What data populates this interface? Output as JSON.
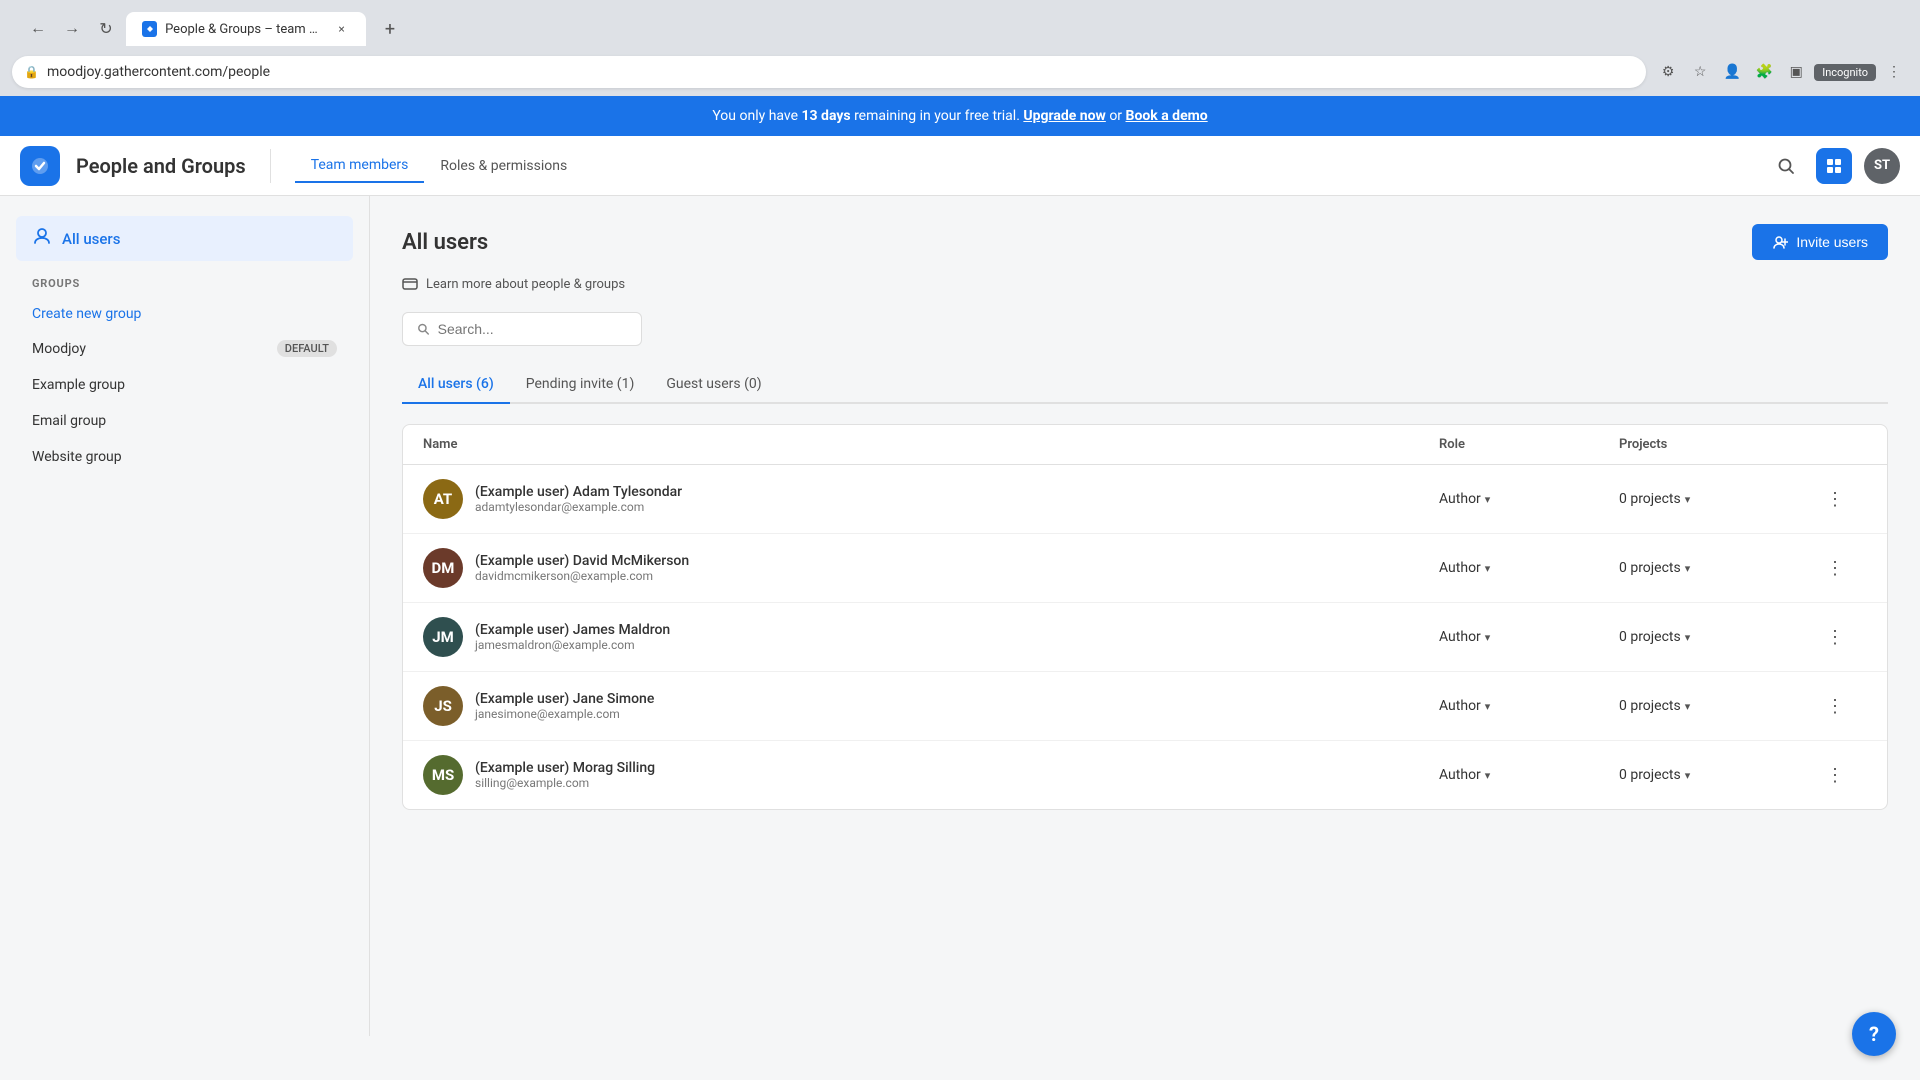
{
  "browser": {
    "tab_title": "People & Groups – team mem…",
    "url": "moodjoy.gathercontent.com/people",
    "new_tab_icon": "+",
    "close_tab_icon": "×",
    "incognito_label": "Incognito"
  },
  "banner": {
    "text_before": "You only have ",
    "days": "13 days",
    "text_middle": " remaining in your free trial. ",
    "upgrade_label": "Upgrade now",
    "text_or": " or ",
    "book_demo_label": "Book a demo"
  },
  "header": {
    "logo_text": "✓",
    "title": "People and Groups",
    "nav": [
      {
        "label": "Team members",
        "active": true
      },
      {
        "label": "Roles & permissions",
        "active": false
      }
    ],
    "avatar_initials": "ST"
  },
  "sidebar": {
    "all_users_label": "All users",
    "groups_header": "GROUPS",
    "create_group_label": "Create new group",
    "groups": [
      {
        "name": "Moodjoy",
        "is_default": true,
        "default_label": "DEFAULT"
      },
      {
        "name": "Example group",
        "is_default": false
      },
      {
        "name": "Email group",
        "is_default": false
      },
      {
        "name": "Website group",
        "is_default": false
      }
    ]
  },
  "content": {
    "page_title": "All users",
    "learn_more_label": "Learn more about people & groups",
    "invite_button_label": "Invite users",
    "search_placeholder": "Search...",
    "tabs": [
      {
        "label": "All users (6)",
        "active": true
      },
      {
        "label": "Pending invite (1)",
        "active": false
      },
      {
        "label": "Guest users (0)",
        "active": false
      }
    ],
    "table_headers": {
      "name": "Name",
      "role": "Role",
      "projects": "Projects"
    },
    "users": [
      {
        "name": "(Example user) Adam Tylesondar",
        "email": "adamtylesondar@example.com",
        "role": "Author",
        "projects": "0 projects",
        "avatar_color": "#8B6914",
        "initials": "AT"
      },
      {
        "name": "(Example user) David McMikerson",
        "email": "davidmcmikerson@example.com",
        "role": "Author",
        "projects": "0 projects",
        "avatar_color": "#6B3A2A",
        "initials": "DM"
      },
      {
        "name": "(Example user) James Maldron",
        "email": "jamesmaldron@example.com",
        "role": "Author",
        "projects": "0 projects",
        "avatar_color": "#2F4F4F",
        "initials": "JM"
      },
      {
        "name": "(Example user) Jane Simone",
        "email": "janesimone@example.com",
        "role": "Author",
        "projects": "0 projects",
        "avatar_color": "#8B6914",
        "initials": "JS"
      },
      {
        "name": "(Example user) Morag Silling",
        "email": "silling@example.com",
        "role": "Author",
        "projects": "0 projects",
        "avatar_color": "#556B2F",
        "initials": "MS"
      }
    ]
  },
  "help_button": "?"
}
